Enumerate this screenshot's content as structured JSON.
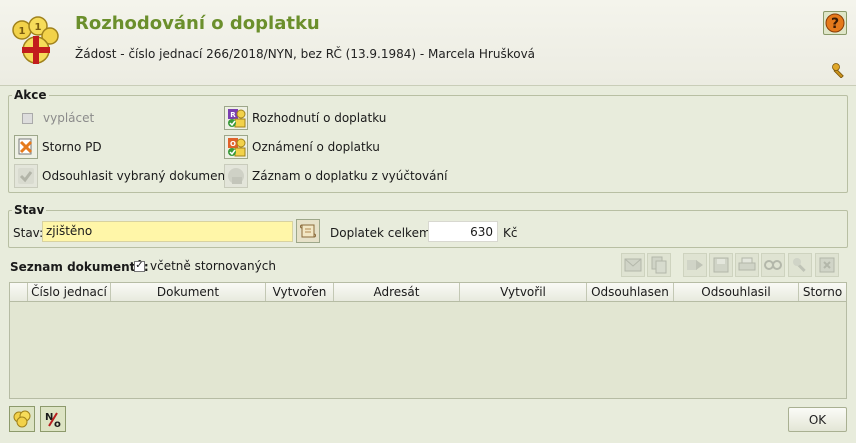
{
  "header": {
    "title": "Rozhodování o doplatku",
    "subtitle": "Žádost - číslo jednací 266/2018/NYN, bez RČ (13.9.1984) - Marcela Hrušková"
  },
  "akce": {
    "legend": "Akce",
    "vyplacet": "vyplácet",
    "storno_pd": "Storno PD",
    "odsouhlasit": "Odsouhlasit vybraný dokument",
    "rozhodnuti": "Rozhodnutí o doplatku",
    "oznameni": "Oznámení o doplatku",
    "zaznam": "Záznam o doplatku z vyúčtování"
  },
  "stav": {
    "legend": "Stav",
    "label": "Stav:",
    "value": "zjištěno",
    "doplatek_label": "Doplatek celkem:",
    "doplatek_value": "630",
    "currency": "Kč"
  },
  "documents": {
    "label": "Seznam dokumentů:",
    "include_cancelled_label": "včetně stornovaných",
    "include_cancelled_checked": true,
    "columns": [
      "",
      "Číslo jednací",
      "Dokument",
      "Vytvořen",
      "Adresát",
      "Vytvořil",
      "Odsouhlasen",
      "Odsouhlasil",
      "Storno"
    ]
  },
  "footer": {
    "ok_label": "OK",
    "no_label": "N/o"
  },
  "colors": {
    "title": "#6b8f2c",
    "background": "#e8ecdc",
    "stav_field": "#fff6a8"
  }
}
